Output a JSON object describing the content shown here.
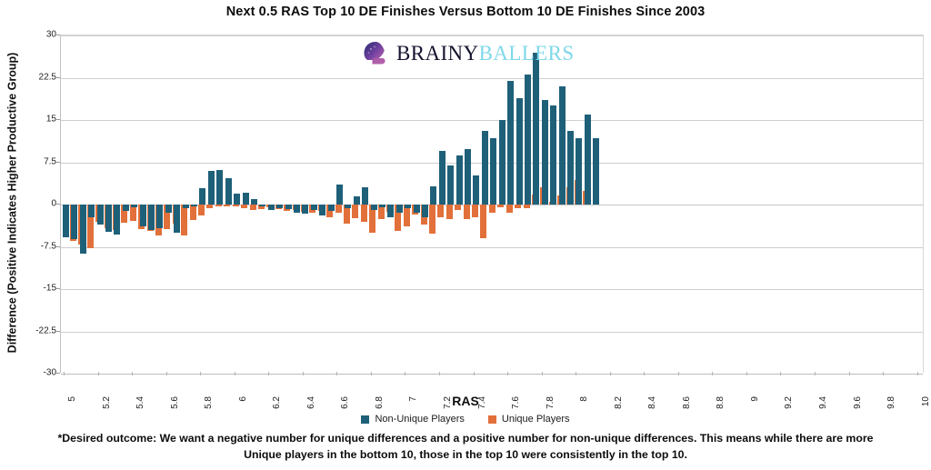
{
  "chart_data": {
    "type": "bar",
    "title": "Next 0.5 RAS Top 10 DE Finishes Versus Bottom 10 DE Finishes Since 2003",
    "xlabel": "RAS",
    "ylabel": "Difference (Positive Indicates Higher Productive Group)",
    "ylim": [
      -30,
      30
    ],
    "yticks": [
      30,
      22.5,
      15,
      7.5,
      0,
      -7.5,
      -15,
      -22.5,
      -30
    ],
    "ytick_labels": [
      "30",
      "22.5",
      "15",
      "7.5",
      "0",
      "-7.5",
      "-15",
      "-22.5",
      "-30"
    ],
    "grid": true,
    "legend_position": "bottom",
    "x_tick_labels": [
      "5",
      "5.2",
      "5.4",
      "5.6",
      "5.8",
      "6",
      "6.2",
      "6.4",
      "6.6",
      "6.8",
      "7",
      "7.2",
      "7.4",
      "7.6",
      "7.8",
      "8",
      "8.2",
      "8.4",
      "8.6",
      "8.8",
      "9",
      "9.2",
      "9.4",
      "9.6",
      "9.8",
      "10"
    ],
    "categories": [
      "5",
      "5.05",
      "5.1",
      "5.15",
      "5.2",
      "5.25",
      "5.3",
      "5.35",
      "5.4",
      "5.45",
      "5.5",
      "5.55",
      "5.6",
      "5.65",
      "5.7",
      "5.75",
      "5.8",
      "5.85",
      "5.9",
      "5.95",
      "6",
      "6.05",
      "6.1",
      "6.15",
      "6.2",
      "6.25",
      "6.3",
      "6.35",
      "6.4",
      "6.45",
      "6.5",
      "6.55",
      "6.6",
      "6.65",
      "6.7",
      "6.75",
      "6.8",
      "6.85",
      "6.9",
      "6.95",
      "7",
      "7.05",
      "7.1",
      "7.15",
      "7.2",
      "7.25",
      "7.3",
      "7.35",
      "7.4",
      "7.45",
      "7.5",
      "7.55",
      "7.6",
      "7.65",
      "7.7",
      "7.75",
      "7.8",
      "7.85",
      "7.9",
      "7.95",
      "8",
      "8.05",
      "8.1",
      "8.15",
      "8.2",
      "8.25",
      "8.3",
      "8.35",
      "8.4",
      "8.45",
      "8.5",
      "8.55",
      "8.6",
      "8.65",
      "8.7",
      "8.75",
      "8.8",
      "8.85",
      "8.9",
      "8.95",
      "9",
      "9.05",
      "9.1",
      "9.15",
      "9.2",
      "9.25",
      "9.3",
      "9.35",
      "9.4",
      "9.45",
      "9.5",
      "9.55",
      "9.6",
      "9.65",
      "9.7",
      "9.75",
      "9.8",
      "9.85",
      "9.9",
      "9.95",
      "10"
    ],
    "series": [
      {
        "name": "Non-Unique Players",
        "color": "#1f6079",
        "values": [
          -5.8,
          -6.2,
          -8.7,
          -2.2,
          -3.5,
          -4.8,
          -5.3,
          -1.2,
          -0.5,
          -3.8,
          -4.5,
          -4.2,
          -1.5,
          -5.0,
          -0.6,
          -0.4,
          2.9,
          6.0,
          6.2,
          4.6,
          2.0,
          2.1,
          0.9,
          -0.3,
          -0.9,
          -0.7,
          -0.8,
          -1.4,
          -1.6,
          -1.0,
          -2.0,
          -1.2,
          3.5,
          -0.6,
          1.5,
          3.0,
          -0.9,
          -0.5,
          -2.3,
          -1.4,
          -0.7,
          -1.5,
          -2.3,
          3.2,
          9.5,
          6.9,
          8.7,
          9.8,
          5.2,
          13.0,
          11.8,
          15.0,
          21.9,
          18.8,
          23.0,
          27.0,
          18.5,
          17.6,
          21.0,
          13.0,
          11.8,
          16.0,
          11.8
        ]
      },
      {
        "name": "Unique Players",
        "color": "#e2703a",
        "values": [
          -6.5,
          -7.1,
          -7.8,
          -3.0,
          -4.2,
          -4.5,
          -3.2,
          -2.9,
          -4.4,
          -4.6,
          -5.5,
          -4.4,
          -3.4,
          -5.5,
          -2.7,
          -2.0,
          -0.7,
          -0.3,
          -0.2,
          -0.3,
          -0.6,
          -0.9,
          -0.8,
          -0.5,
          -0.8,
          -1.1,
          -1.0,
          -1.3,
          -1.5,
          -1.2,
          -2.2,
          -1.4,
          -3.4,
          -2.4,
          -3.1,
          -5.0,
          -2.5,
          -1.3,
          -4.6,
          -3.9,
          -1.8,
          -3.6,
          -5.2,
          -2.3,
          -2.6,
          -0.9,
          -2.5,
          -2.3,
          -5.9,
          -1.5,
          -0.5,
          -1.4,
          -0.7,
          -0.6,
          1.8,
          3.0,
          0.5,
          1.6,
          3.0,
          4.3,
          2.5
        ]
      }
    ]
  },
  "legend": [
    {
      "label": "Non-Unique Players",
      "color": "#1f6079"
    },
    {
      "label": "Unique Players",
      "color": "#e2703a"
    }
  ],
  "logo": {
    "primary_text": "BRAINY",
    "secondary_text": "BALLERS",
    "primary_color": "#14132e",
    "secondary_color": "#7fd8e8",
    "icon": "football-helmet-icon"
  },
  "footnote": {
    "line1": "*Desired outcome: We want a negative number for unique differences and a positive number for non-unique differences. This means while there",
    "line2": "are more Unique players in the bottom 10, those in the top 10 were consistently in the top 10."
  }
}
